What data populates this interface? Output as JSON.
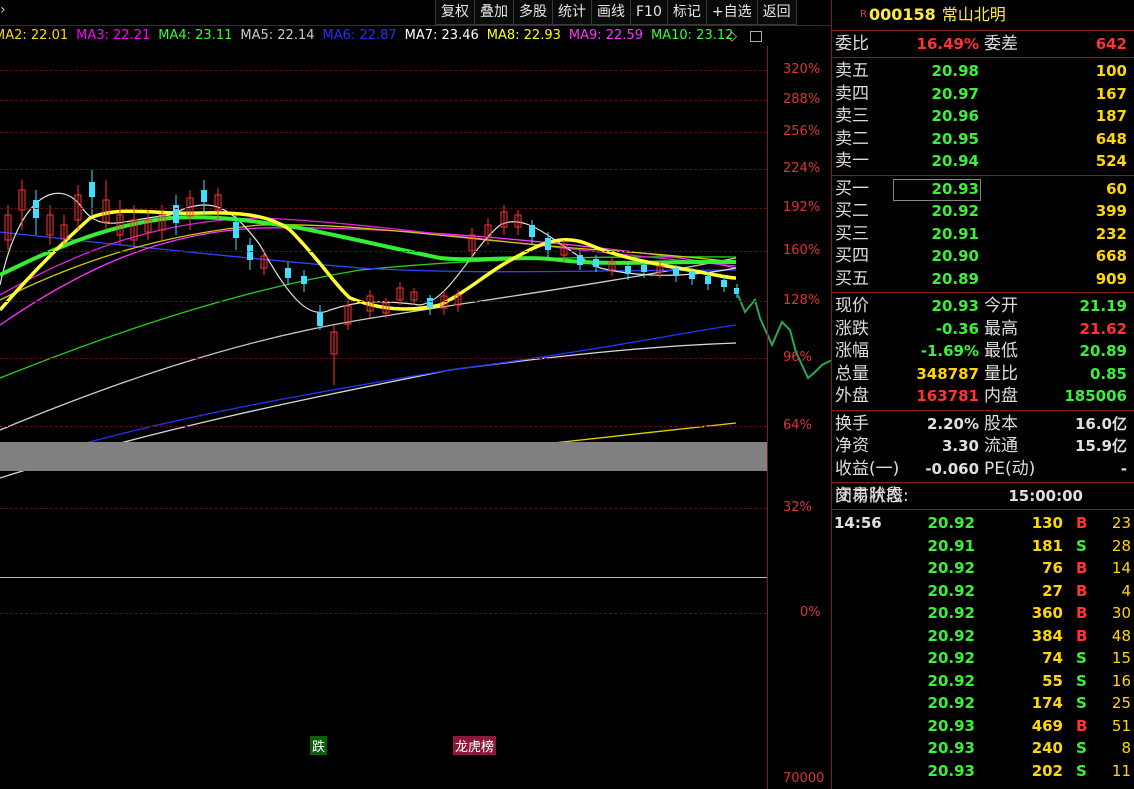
{
  "toolbar": {
    "buttons": [
      "复权",
      "叠加",
      "多股",
      "统计",
      "画线",
      "F10",
      "标记",
      "+自选",
      "返回"
    ]
  },
  "ma_legend": [
    {
      "label": "MA2:",
      "value": "22.01",
      "color": "#ffd700"
    },
    {
      "label": "MA3:",
      "value": "22.21",
      "color": "#ff00ff"
    },
    {
      "label": "MA4:",
      "value": "23.11",
      "color": "#33ff33"
    },
    {
      "label": "MA5:",
      "value": "22.14",
      "color": "#cccccc"
    },
    {
      "label": "MA6:",
      "value": "22.87",
      "color": "#2233ff"
    },
    {
      "label": "MA7:",
      "value": "23.46",
      "color": "#ffffff"
    },
    {
      "label": "MA8:",
      "value": "22.93",
      "color": "#ffff00"
    },
    {
      "label": "MA9:",
      "value": "22.59",
      "color": "#ff33ff"
    },
    {
      "label": "MA10:",
      "value": "23.12",
      "color": "#33ff33"
    }
  ],
  "axis": {
    "percent_labels": [
      "320%",
      "288%",
      "256%",
      "224%",
      "192%",
      "160%",
      "128%",
      "96%",
      "64%",
      "32%",
      "0%"
    ],
    "volume_label": "70000"
  },
  "markers": {
    "die": "跌",
    "board": "龙虎榜"
  },
  "stock": {
    "flag": "R",
    "code": "000158",
    "name": "常山北明"
  },
  "order_ratio": {
    "label": "委比",
    "value": "16.49%",
    "diff_label": "委差",
    "diff_value": "642"
  },
  "asks": [
    {
      "label": "卖五",
      "price": "20.98",
      "volume": "100"
    },
    {
      "label": "卖四",
      "price": "20.97",
      "volume": "167"
    },
    {
      "label": "卖三",
      "price": "20.96",
      "volume": "187"
    },
    {
      "label": "卖二",
      "price": "20.95",
      "volume": "648"
    },
    {
      "label": "卖一",
      "price": "20.94",
      "volume": "524"
    }
  ],
  "bids": [
    {
      "label": "买一",
      "price": "20.93",
      "volume": "60"
    },
    {
      "label": "买二",
      "price": "20.92",
      "volume": "399"
    },
    {
      "label": "买三",
      "price": "20.91",
      "volume": "232"
    },
    {
      "label": "买四",
      "price": "20.90",
      "volume": "668"
    },
    {
      "label": "买五",
      "price": "20.89",
      "volume": "909"
    }
  ],
  "quote": [
    {
      "l1": "现价",
      "v1": "20.93",
      "c1": "green",
      "l2": "今开",
      "v2": "21.19",
      "c2": "green"
    },
    {
      "l1": "涨跌",
      "v1": "-0.36",
      "c1": "green",
      "l2": "最高",
      "v2": "21.62",
      "c2": "red"
    },
    {
      "l1": "涨幅",
      "v1": "-1.69%",
      "c1": "green",
      "l2": "最低",
      "v2": "20.89",
      "c2": "green"
    },
    {
      "l1": "总量",
      "v1": "348787",
      "c1": "yellow",
      "l2": "量比",
      "v2": "0.85",
      "c2": "green"
    },
    {
      "l1": "外盘",
      "v1": "163781",
      "c1": "red",
      "l2": "内盘",
      "v2": "185006",
      "c2": "green"
    }
  ],
  "fundamentals": [
    {
      "l1": "换手",
      "v1": "2.20%",
      "l2": "股本",
      "v2": "16.0亿"
    },
    {
      "l1": "净资",
      "v1": "3.30",
      "l2": "流通",
      "v2": "15.9亿"
    },
    {
      "l1": "收益(一)",
      "v1": "-0.060",
      "l2": "PE(动)",
      "v2": "-"
    }
  ],
  "trade_status": {
    "label": "交易状态:",
    "value": "闭市阶段",
    "time": "15:00:00"
  },
  "ticks": [
    {
      "time": "14:56",
      "price": "20.92",
      "volume": "130",
      "side": "B",
      "count": "23"
    },
    {
      "time": "",
      "price": "20.91",
      "volume": "181",
      "side": "S",
      "count": "28"
    },
    {
      "time": "",
      "price": "20.92",
      "volume": "76",
      "side": "B",
      "count": "14"
    },
    {
      "time": "",
      "price": "20.92",
      "volume": "27",
      "side": "B",
      "count": "4"
    },
    {
      "time": "",
      "price": "20.92",
      "volume": "360",
      "side": "B",
      "count": "30"
    },
    {
      "time": "",
      "price": "20.92",
      "volume": "384",
      "side": "B",
      "count": "48"
    },
    {
      "time": "",
      "price": "20.92",
      "volume": "74",
      "side": "S",
      "count": "15"
    },
    {
      "time": "",
      "price": "20.92",
      "volume": "55",
      "side": "S",
      "count": "16"
    },
    {
      "time": "",
      "price": "20.92",
      "volume": "174",
      "side": "S",
      "count": "25"
    },
    {
      "time": "",
      "price": "20.93",
      "volume": "469",
      "side": "B",
      "count": "51"
    },
    {
      "time": "",
      "price": "20.93",
      "volume": "240",
      "side": "S",
      "count": "8"
    },
    {
      "time": "",
      "price": "20.93",
      "volume": "202",
      "side": "S",
      "count": "11"
    }
  ]
}
